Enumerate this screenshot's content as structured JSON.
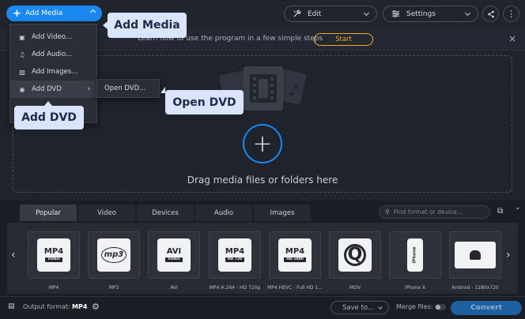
{
  "toolbar": {
    "add_media_label": "Add Media",
    "edit_label": "Edit",
    "settings_label": "Settings"
  },
  "banner": {
    "text": "Learn how to use the program in a few simple steps",
    "start_label": "Start"
  },
  "dropzone": {
    "text": "Drag media files or folders here"
  },
  "add_menu": {
    "items": [
      {
        "label": "Add Video...",
        "icon": "video-frame-icon"
      },
      {
        "label": "Add Audio...",
        "icon": "music-note-icon"
      },
      {
        "label": "Add Images...",
        "icon": "image-icon"
      },
      {
        "label": "Add DVD",
        "icon": "disc-icon"
      }
    ],
    "submenu": {
      "label": "Open DVD..."
    }
  },
  "callouts": {
    "add_media": "Add Media",
    "add_dvd": "Add DVD",
    "open_dvd": "Open DVD"
  },
  "format_tabs": [
    "Popular",
    "Video",
    "Devices",
    "Audio",
    "Images"
  ],
  "active_tab": "Popular",
  "search": {
    "placeholder": "Find format or device..."
  },
  "formats": [
    {
      "label": "MP4",
      "icon_text": "MP4",
      "sub": "VIDEO"
    },
    {
      "label": "MP3",
      "icon_text": "mp3",
      "sub": ""
    },
    {
      "label": "AVI",
      "icon_text": "AVI",
      "sub": "VIDEO"
    },
    {
      "label": "MP4 H.264 - HD 720p",
      "icon_text": "MP4",
      "sub": "HD 720"
    },
    {
      "label": "MP4 HEVC - Full HD 1...",
      "icon_text": "MP4",
      "sub": "HD 1080"
    },
    {
      "label": "MOV",
      "icon_text": "Q",
      "sub": ""
    },
    {
      "label": "iPhone X",
      "icon_text": "iPhone",
      "sub": ""
    },
    {
      "label": "Android - 1280x720",
      "icon_text": "android",
      "sub": ""
    }
  ],
  "footer": {
    "output_format_label": "Output format:",
    "output_format_value": "MP4",
    "save_to_label": "Save to...",
    "merge_label": "Merge files:",
    "convert_label": "Convert"
  },
  "colors": {
    "accent": "#1a88f0",
    "start_orange": "#f5a623",
    "callout_bg": "#dbe4ff"
  }
}
